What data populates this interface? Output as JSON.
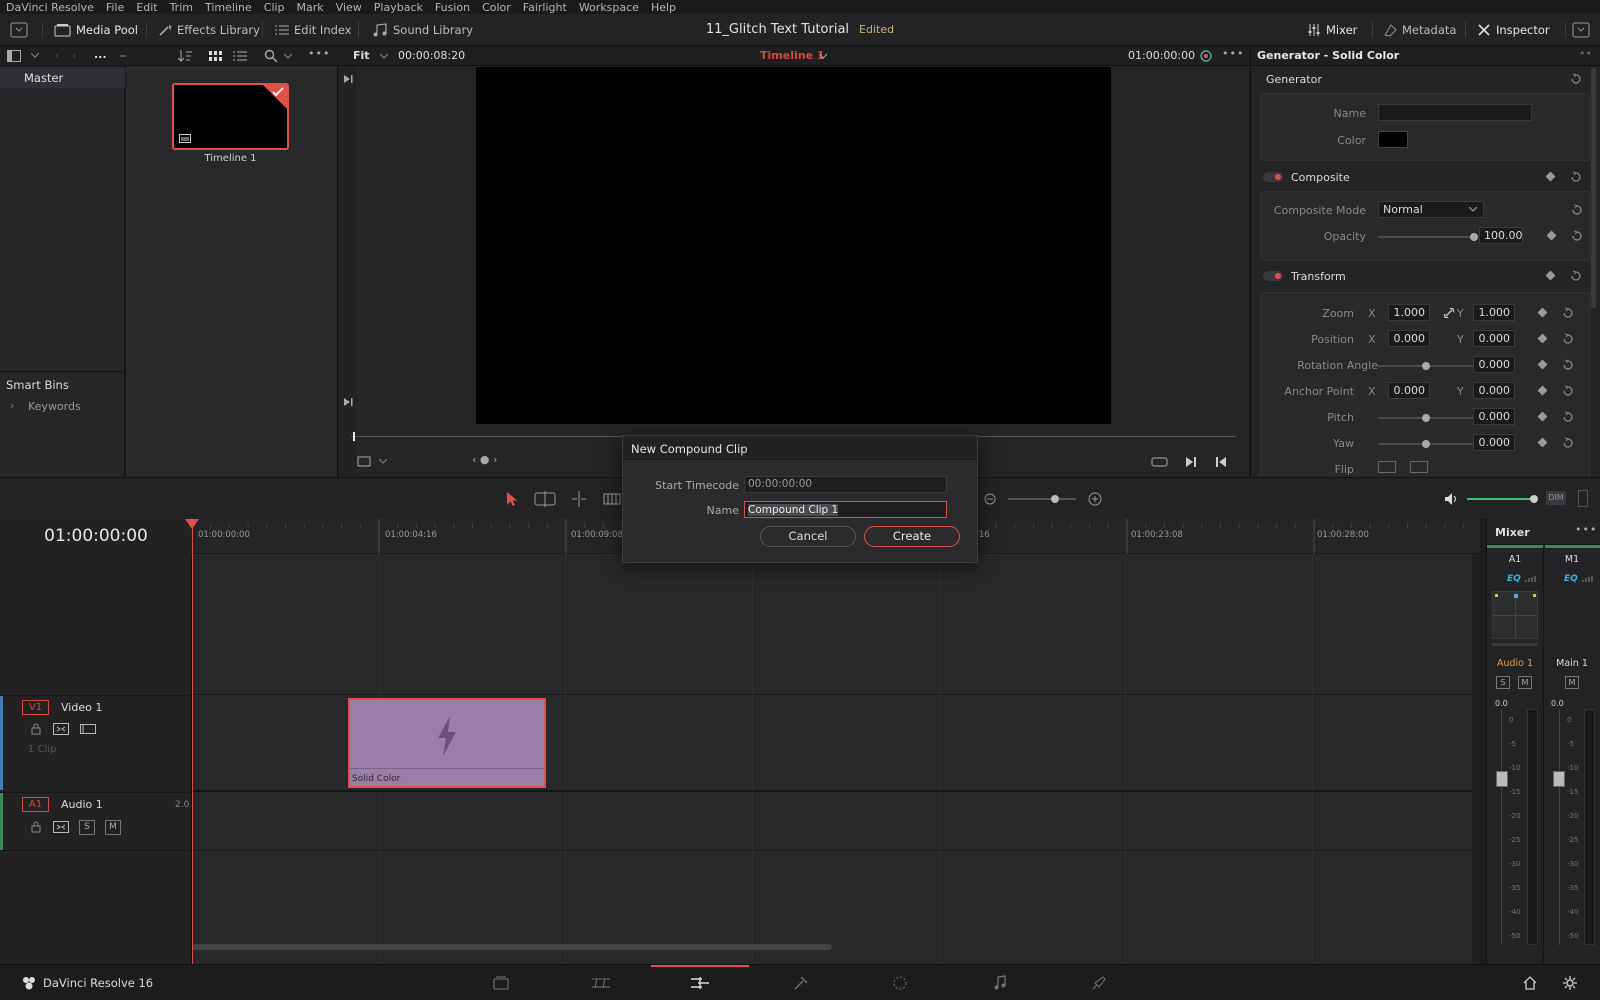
{
  "menu": [
    "DaVinci Resolve",
    "File",
    "Edit",
    "Trim",
    "Timeline",
    "Clip",
    "Mark",
    "View",
    "Playback",
    "Fusion",
    "Color",
    "Fairlight",
    "Workspace",
    "Help"
  ],
  "toolbar": {
    "media_pool": "Media Pool",
    "effects_library": "Effects Library",
    "edit_index": "Edit Index",
    "sound_library": "Sound Library",
    "project_title": "11_Glitch Text Tutorial",
    "edited": "Edited",
    "mixer": "Mixer",
    "metadata": "Metadata",
    "inspector": "Inspector"
  },
  "media_pool": {
    "path_label": "...",
    "master": "Master",
    "smart_bins": "Smart Bins",
    "keywords": "Keywords",
    "clip_name": "Timeline 1"
  },
  "viewer": {
    "zoom": "Fit",
    "duration_timecode": "00:00:08:20",
    "timeline_name": "Timeline 1",
    "current_timecode": "01:00:00:00"
  },
  "inspector": {
    "title": "Generator - Solid Color",
    "generator_section": "Generator",
    "name_label": "Name",
    "name_value": "",
    "color_label": "Color",
    "composite_section": "Composite",
    "composite_mode_label": "Composite Mode",
    "composite_mode_value": "Normal",
    "opacity_label": "Opacity",
    "opacity_value": "100.00",
    "transform_section": "Transform",
    "zoom_label": "Zoom",
    "zoom_x": "1.000",
    "zoom_y": "1.000",
    "position_label": "Position",
    "position_x": "0.000",
    "position_y": "0.000",
    "rotation_label": "Rotation Angle",
    "rotation_value": "0.000",
    "anchor_label": "Anchor Point",
    "anchor_x": "0.000",
    "anchor_y": "0.000",
    "pitch_label": "Pitch",
    "pitch_value": "0.000",
    "yaw_label": "Yaw",
    "yaw_value": "0.000",
    "flip_label": "Flip",
    "x_axis": "X",
    "y_axis": "Y"
  },
  "timeline": {
    "timecode": "01:00:00:00",
    "ruler_ticks": [
      "01:00:00:00",
      "01:00:04:16",
      "01:00:09:08",
      ":16",
      "01:00:23:08",
      "01:00:28:00"
    ],
    "video_track": {
      "id": "V1",
      "name": "Video 1",
      "clip_count": "1 Clip"
    },
    "audio_track": {
      "id": "A1",
      "name": "Audio 1",
      "channels": "2.0",
      "solo": "S",
      "mute": "M"
    },
    "clip_label": "Solid Color"
  },
  "mixer": {
    "title": "Mixer",
    "dim": "DIM",
    "channels": [
      {
        "id": "A1",
        "eq": "EQ",
        "name": "Audio 1",
        "level": "0.0"
      },
      {
        "id": "M1",
        "eq": "EQ",
        "name": "Main 1",
        "level": "0.0"
      }
    ],
    "scale": [
      "0",
      "-5",
      "-10",
      "-15",
      "-20",
      "-25",
      "-30",
      "-35",
      "-40",
      "-50"
    ],
    "solo": "S",
    "mute": "M"
  },
  "dialog": {
    "title": "New Compound Clip",
    "start_timecode_label": "Start Timecode",
    "start_timecode_value": "00:00:00:00",
    "name_label": "Name",
    "name_value": "Compound Clip 1",
    "cancel": "Cancel",
    "create": "Create"
  },
  "status": {
    "app_name": "DaVinci Resolve 16"
  },
  "colors": {
    "accent_red": "#e0504a",
    "clip_purple": "#9a7ea8",
    "timecode_red": "#d44a3f"
  }
}
